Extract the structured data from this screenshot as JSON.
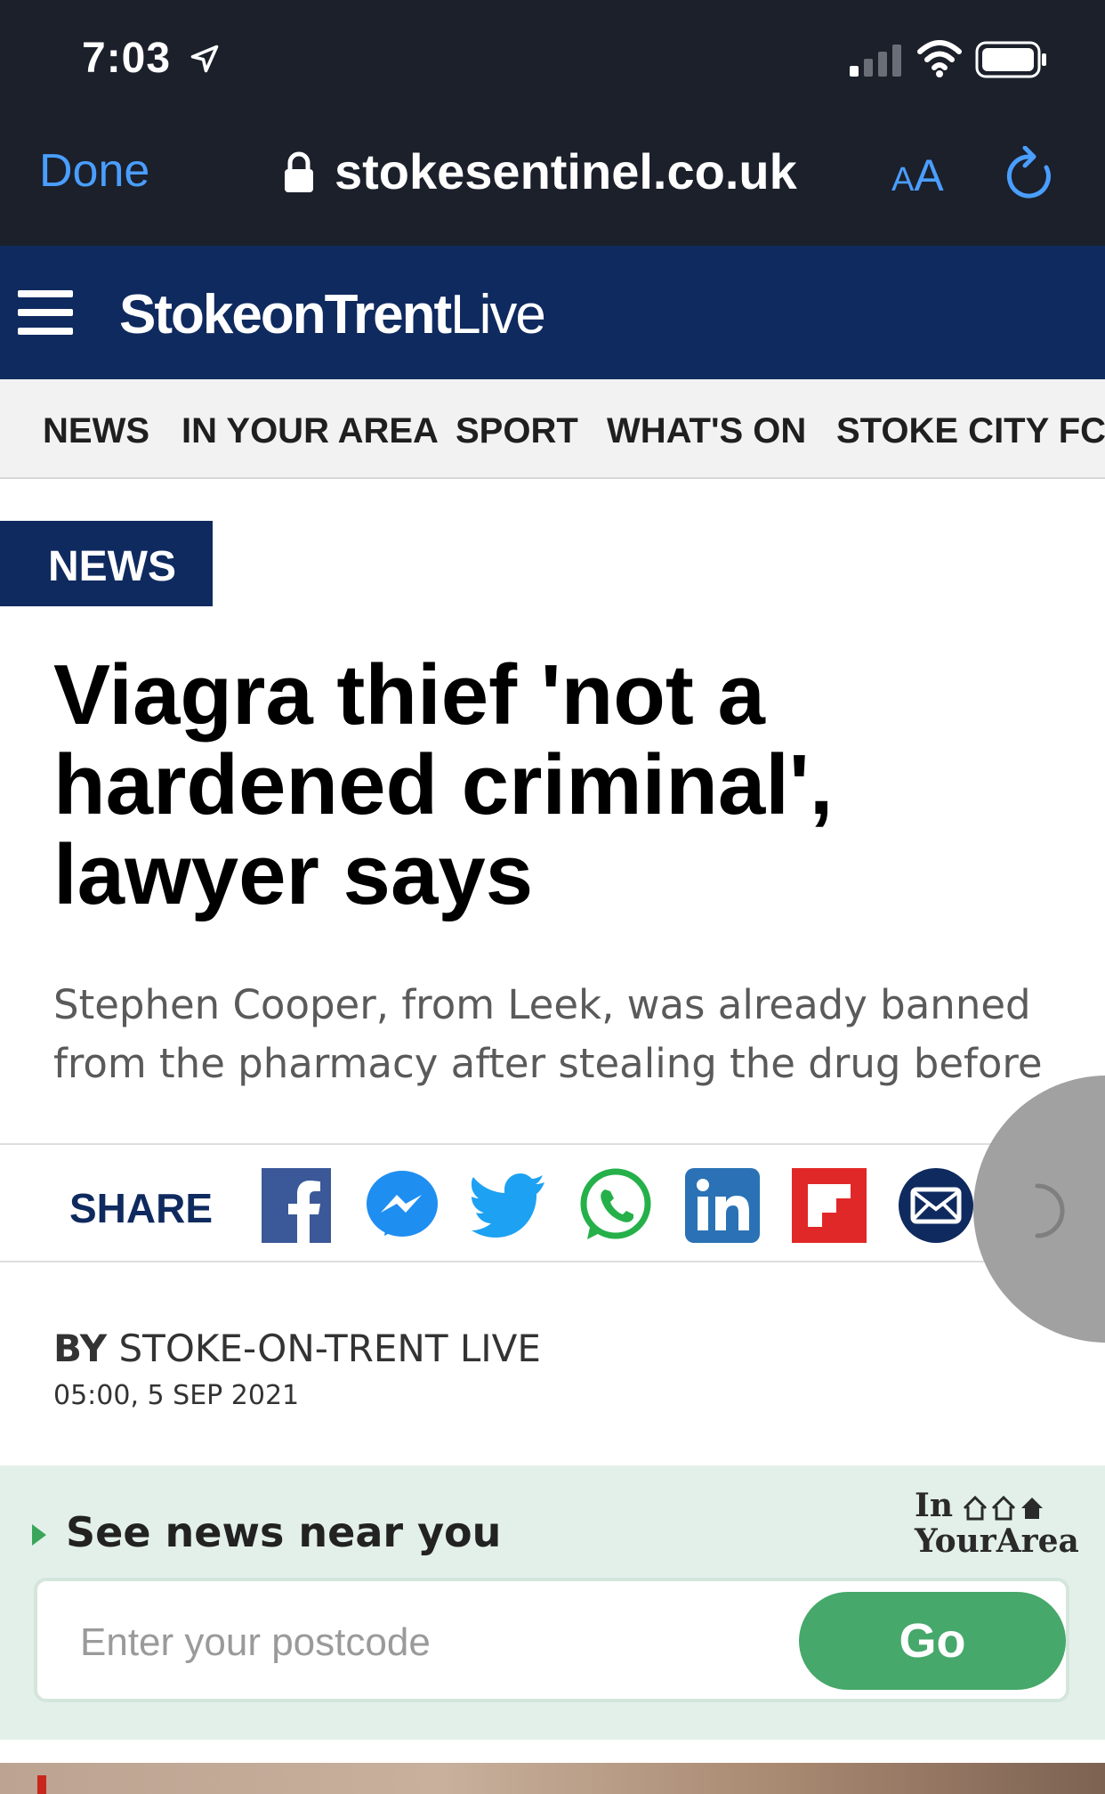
{
  "status_bar": {
    "time": "7:03"
  },
  "browser": {
    "done_label": "Done",
    "url": "stokesentinel.co.uk",
    "aa_small": "A",
    "aa_large": "A"
  },
  "site": {
    "logo_bold": "StokeonTrent",
    "logo_light": "Live",
    "nav": [
      "NEWS",
      "IN YOUR AREA",
      "SPORT",
      "WHAT'S ON",
      "STOKE CITY FC"
    ]
  },
  "article": {
    "section_tag": "NEWS",
    "headline": "Viagra thief 'not a hardened criminal', lawyer says",
    "standfirst": "Stephen Cooper, from Leek, was already banned from the pharmacy after stealing the drug before",
    "share_label": "SHARE",
    "share_icons": [
      "facebook-icon",
      "messenger-icon",
      "twitter-icon",
      "whatsapp-icon",
      "linkedin-icon",
      "flipboard-icon",
      "email-icon"
    ],
    "byline_prefix": "BY",
    "byline_author": "STOKE-ON-TRENT LIVE",
    "date": "05:00, 5 SEP 2021"
  },
  "in_your_area": {
    "title": "See news near you",
    "logo_line1": "In",
    "logo_line2": "YourArea",
    "postcode_placeholder": "Enter your postcode",
    "postcode_value": "",
    "go_label": "Go"
  },
  "colors": {
    "brand_navy": "#0f2a5f",
    "ios_blue": "#4a9eff",
    "go_green": "#46a86a",
    "widget_bg": "#e3f0ea"
  }
}
